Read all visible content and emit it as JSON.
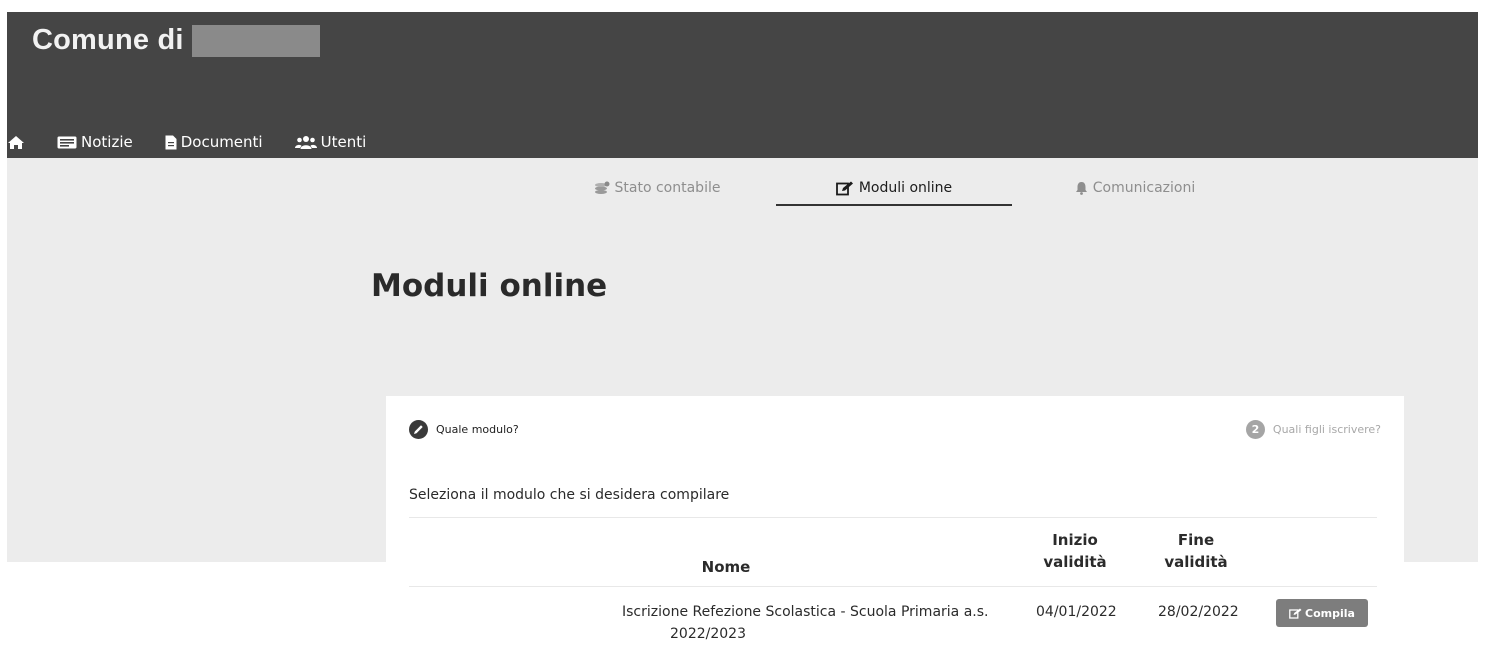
{
  "header": {
    "brand": "Comune di",
    "nav": [
      {
        "label": "",
        "icon": "home-icon"
      },
      {
        "label": "Notizie",
        "icon": "newspaper-icon"
      },
      {
        "label": "Documenti",
        "icon": "document-icon"
      },
      {
        "label": "Utenti",
        "icon": "users-icon"
      }
    ]
  },
  "tabs": [
    {
      "label": "Stato contabile",
      "icon": "coins-icon",
      "active": false
    },
    {
      "label": "Moduli online",
      "icon": "edit-icon",
      "active": true
    },
    {
      "label": "Comunicazioni",
      "icon": "bell-icon",
      "active": false
    }
  ],
  "page": {
    "title": "Moduli online"
  },
  "wizard": {
    "step1": {
      "label": "Quale modulo?"
    },
    "step2": {
      "number": "2",
      "label": "Quali figli iscrivere?"
    }
  },
  "instruction": "Seleziona il modulo che si desidera compilare",
  "table": {
    "headers": {
      "nome": "Nome",
      "inizio_line1": "Inizio",
      "inizio_line2": "validità",
      "fine_line1": "Fine",
      "fine_line2": "validità"
    },
    "rows": [
      {
        "nome_line1": "Iscrizione Refezione Scolastica - Scuola Primaria a.s.",
        "nome_line2": "2022/2023",
        "inizio": "04/01/2022",
        "fine": "28/02/2022",
        "action": "Compila"
      }
    ]
  },
  "colors": {
    "header_bg": "#454545",
    "band_bg": "#ececec",
    "button_bg": "#7d7d7d"
  }
}
